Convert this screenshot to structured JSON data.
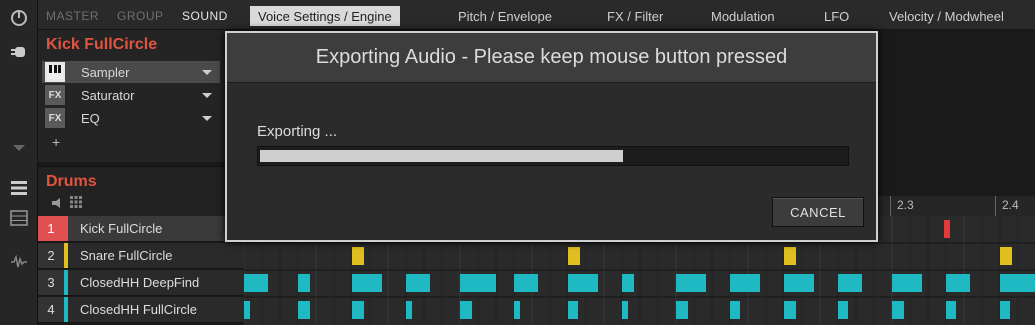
{
  "colors": {
    "accent": "#e0553f",
    "selected_row": "#e05050",
    "snare": "#e0c020",
    "hihat": "#1fb9c4",
    "clip_marker": "#e03a3a"
  },
  "nav": {
    "master_label": "MASTER",
    "group_label": "GROUP",
    "sound_label": "SOUND"
  },
  "tabs": [
    {
      "label": "Voice Settings / Engine",
      "active": true
    },
    {
      "label": "Pitch / Envelope"
    },
    {
      "label": "FX / Filter"
    },
    {
      "label": "Modulation"
    },
    {
      "label": "LFO"
    },
    {
      "label": "Velocity / Modwheel"
    }
  ],
  "sound": {
    "name": "Kick FullCircle",
    "slots": [
      {
        "label": "Sampler",
        "icon": "keyboard-icon",
        "selected": true
      },
      {
        "label": "Saturator",
        "icon": "fx-icon"
      },
      {
        "label": "EQ",
        "icon": "fx-icon"
      }
    ],
    "add_label": "+"
  },
  "group": {
    "name": "Drums"
  },
  "sounds": [
    {
      "num": "1",
      "name": "Kick FullCircle",
      "selected": true
    },
    {
      "num": "2",
      "name": "Snare FullCircle"
    },
    {
      "num": "3",
      "name": "ClosedHH DeepFind"
    },
    {
      "num": "4",
      "name": "ClosedHH FullCircle"
    }
  ],
  "ruler": [
    "2.3",
    "2.4"
  ],
  "dialog": {
    "title": "Exporting Audio - Please keep mouse button pressed",
    "status": "Exporting ...",
    "progress": 0.62,
    "cancel_label": "CANCEL"
  }
}
